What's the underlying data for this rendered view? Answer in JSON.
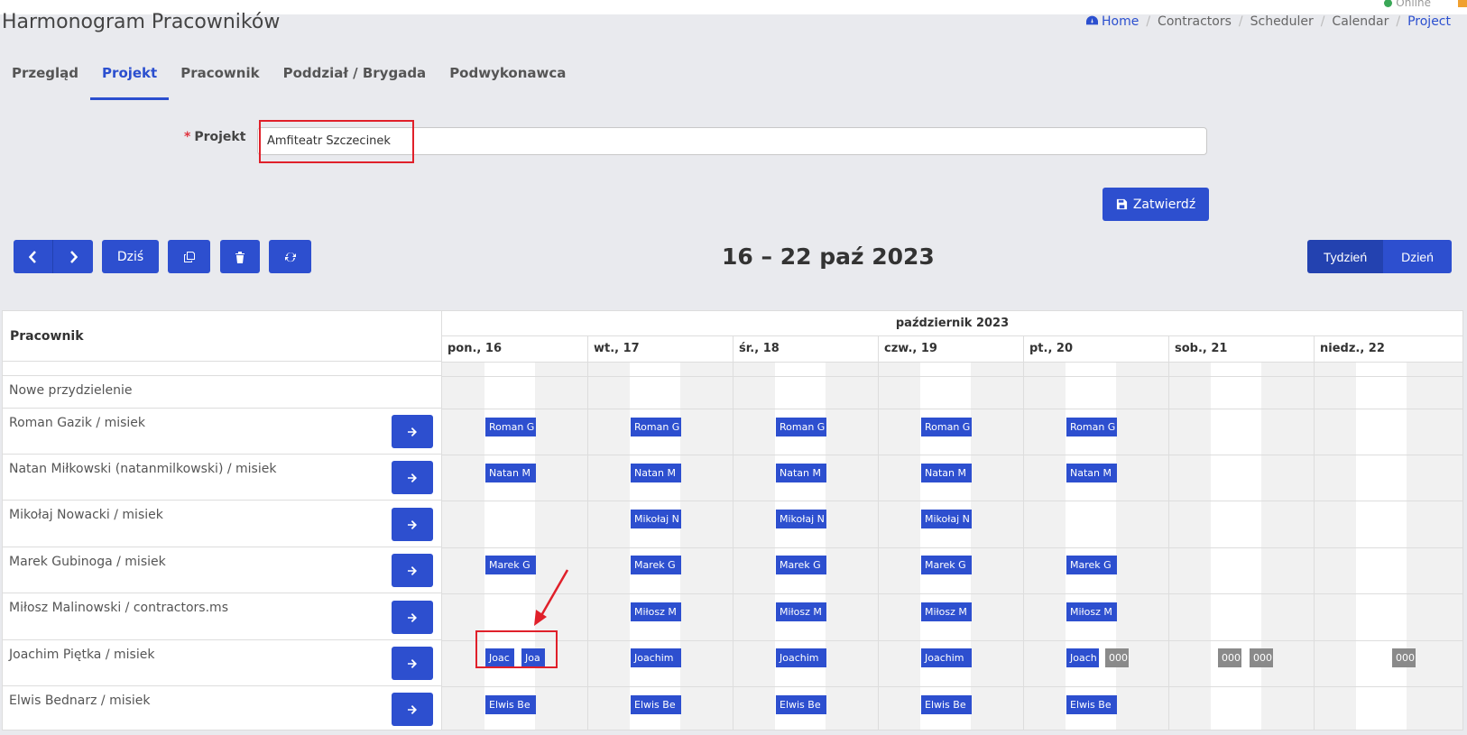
{
  "app": {
    "title": "Harmonogram Pracowników",
    "status": "Online"
  },
  "breadcrumb": [
    "Home",
    "Contractors",
    "Scheduler",
    "Calendar",
    "Project"
  ],
  "tabs": [
    "Przegląd",
    "Projekt",
    "Pracownik",
    "Poddział / Brygada",
    "Podwykonawca"
  ],
  "active_tab": "Projekt",
  "form": {
    "project_label": "Projekt",
    "project_value": "Amfiteatr Szczecinek",
    "submit_label": "Zatwierdź"
  },
  "toolbar": {
    "today_label": "Dziś",
    "range_title": "16 – 22 paź 2023",
    "view_week": "Tydzień",
    "view_day": "Dzień"
  },
  "scheduler": {
    "resource_header": "Pracownik",
    "month_label": "październik 2023",
    "days": [
      "pon., 16",
      "wt., 17",
      "śr., 18",
      "czw., 19",
      "pt., 20",
      "sob., 21",
      "niedz., 22"
    ],
    "rows": [
      {
        "name": "Nowe przydzielenie"
      },
      {
        "name": "Roman Gazik / misiek"
      },
      {
        "name": "Natan Miłkowski (natanmilkowski) / misiek"
      },
      {
        "name": "Mikołaj Nowacki / misiek"
      },
      {
        "name": "Marek Gubinoga / misiek"
      },
      {
        "name": "Miłosz Malinowski / contractors.ms"
      },
      {
        "name": "Joachim Piętka / misiek"
      },
      {
        "name": "Elwis Bednarz / misiek"
      }
    ],
    "events": {
      "roman": "Roman G",
      "natan": "Natan M",
      "mikolaj": "Mikołaj N",
      "marek": "Marek G",
      "milosz": "Miłosz M",
      "joachim_short": "Joac",
      "joachim_short2": "Joa",
      "joachim": "Joachim",
      "joachim_fri": "Joach",
      "elwis": "Elwis Be",
      "code": "000"
    }
  },
  "colors": {
    "accent": "#2d4fcf",
    "event": "#2d4fcf",
    "event_gray": "#8a8a8a",
    "highlight": "#e0202a"
  }
}
